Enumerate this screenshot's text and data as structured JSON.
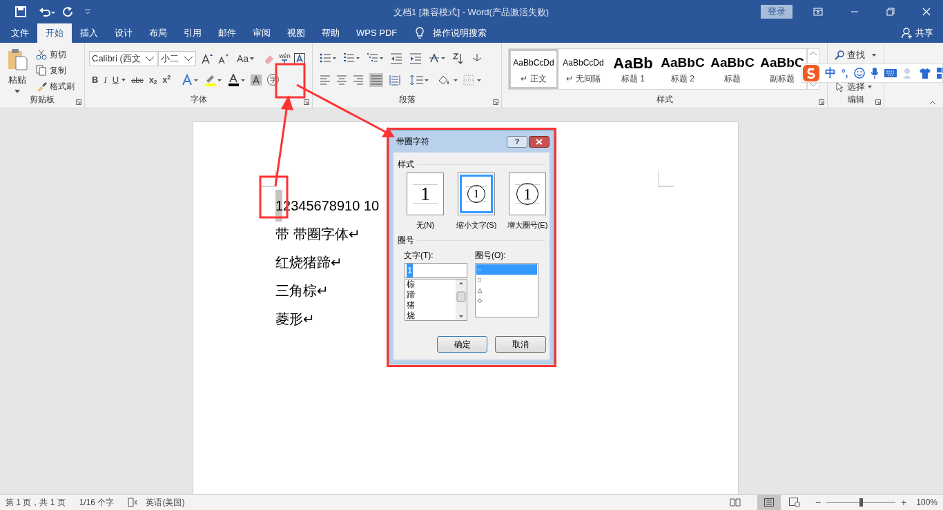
{
  "title_bar": {
    "title": "文档1 [兼容模式] - Word(产品激活失败)",
    "login": "登录"
  },
  "tabs": [
    {
      "label": "文件",
      "selected": false
    },
    {
      "label": "开始",
      "selected": true
    },
    {
      "label": "插入",
      "selected": false
    },
    {
      "label": "设计",
      "selected": false
    },
    {
      "label": "布局",
      "selected": false
    },
    {
      "label": "引用",
      "selected": false
    },
    {
      "label": "邮件",
      "selected": false
    },
    {
      "label": "审阅",
      "selected": false
    },
    {
      "label": "视图",
      "selected": false
    },
    {
      "label": "帮助",
      "selected": false
    },
    {
      "label": "WPS PDF",
      "selected": false
    }
  ],
  "tell_me": "操作说明搜索",
  "share": "共享",
  "clipboard": {
    "paste": "粘贴",
    "actions": [
      "剪切",
      "复制",
      "格式刷"
    ],
    "label": "剪贴板"
  },
  "font": {
    "font_name": "Calibri (西文",
    "font_size": "小二",
    "case_button": "Aa",
    "phonetic": "wén",
    "format_buttons": [
      "B",
      "I",
      "U",
      "abc",
      "x$_{2}$",
      "x$^{2}$"
    ],
    "enclose_button": "字",
    "label": "字体"
  },
  "paragraph": {
    "label": "段落"
  },
  "styles": {
    "items": [
      {
        "preview": "AaBbCcDd",
        "name": "↵ 正文",
        "kind": "plain",
        "selected": true
      },
      {
        "preview": "AaBbCcDd",
        "name": "↵ 无间隔",
        "kind": "plain",
        "selected": false
      },
      {
        "preview": "AaBb",
        "name": "标题 1",
        "kind": "big",
        "selected": false
      },
      {
        "preview": "AaBbC",
        "name": "标题 2",
        "kind": "bold",
        "selected": false
      },
      {
        "preview": "AaBbC",
        "name": "标题",
        "kind": "bold",
        "selected": false
      },
      {
        "preview": "AaBbC",
        "name": "副标题",
        "kind": "bold",
        "selected": false
      }
    ],
    "label": "样式"
  },
  "editing": {
    "find": "查找",
    "select": "选择",
    "label": "编辑"
  },
  "ime": {
    "mode": "中",
    "punct": "°,"
  },
  "document": {
    "lines": [
      "12345678910 10",
      "带  带圈字体↵",
      "红烧猪蹄↵",
      "三角棕↵",
      "菱形↵"
    ]
  },
  "dialog": {
    "title": "带圈字符",
    "help": "?",
    "style_heading": "样式",
    "styles": [
      {
        "label": "无(N)",
        "sample": "1",
        "kind": "none",
        "selected": false
      },
      {
        "label": "缩小文字(S)",
        "sample": "1",
        "kind": "shrink",
        "selected": true
      },
      {
        "label": "增大圈号(E)",
        "sample": "1",
        "kind": "enlarge",
        "selected": false
      }
    ],
    "enclosure_heading": "圈号",
    "text_label": "文字(T):",
    "text_value": "1",
    "text_items": [
      "棕",
      "蹄",
      "猪",
      "烧"
    ],
    "symbol_label": "圈号(O):",
    "symbols": [
      {
        "symbol": "○",
        "selected": true
      },
      {
        "symbol": "□",
        "selected": false
      },
      {
        "symbol": "△",
        "selected": false
      },
      {
        "symbol": "◇",
        "selected": false
      }
    ],
    "ok": "确定",
    "cancel": "取消"
  },
  "status_bar": {
    "page": "第 1 页，共 1 页",
    "words": "1/16 个字",
    "language": "英语(美国)",
    "zoom_out": "−",
    "zoom_slider": {
      "level": 0.5
    },
    "zoom_in": "+",
    "zoom": "100%"
  }
}
